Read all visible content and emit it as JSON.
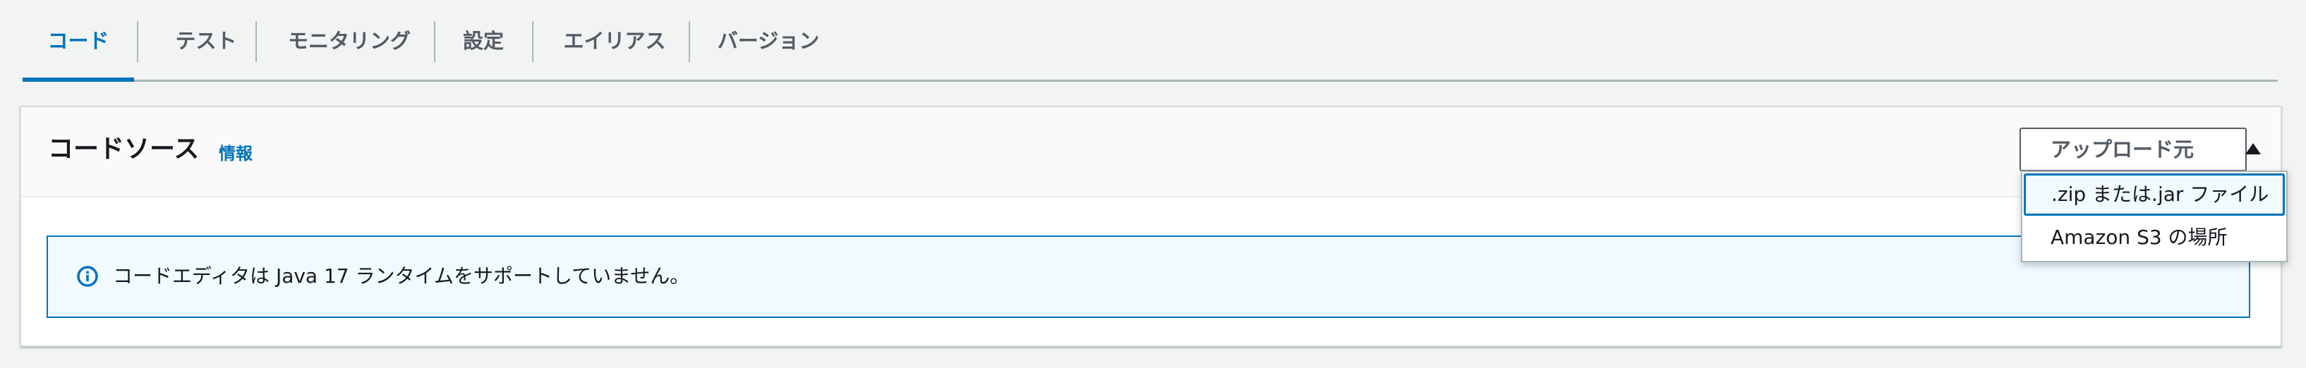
{
  "tabs": [
    {
      "label": "コード",
      "active": true
    },
    {
      "label": "テスト",
      "active": false
    },
    {
      "label": "モニタリング",
      "active": false
    },
    {
      "label": "設定",
      "active": false
    },
    {
      "label": "エイリアス",
      "active": false
    },
    {
      "label": "バージョン",
      "active": false
    }
  ],
  "code_source": {
    "title": "コードソース",
    "info_link": "情報",
    "upload_button": "アップロード元",
    "upload_icon": "caret-up-icon",
    "dropdown": [
      {
        "label": ".zip または.jar ファイル",
        "highlighted": true
      },
      {
        "label": "Amazon S3 の場所",
        "highlighted": false
      }
    ]
  },
  "alert": {
    "icon": "info-icon",
    "message": "コードエディタは Java 17 ランタイムをサポートしていません。"
  },
  "colors": {
    "accent": "#0073bb",
    "page_background": "#f2f3f3",
    "alert_background": "#f1faff",
    "text": "#16191f",
    "muted_text": "#545b64",
    "divider": "#aab7b8"
  }
}
